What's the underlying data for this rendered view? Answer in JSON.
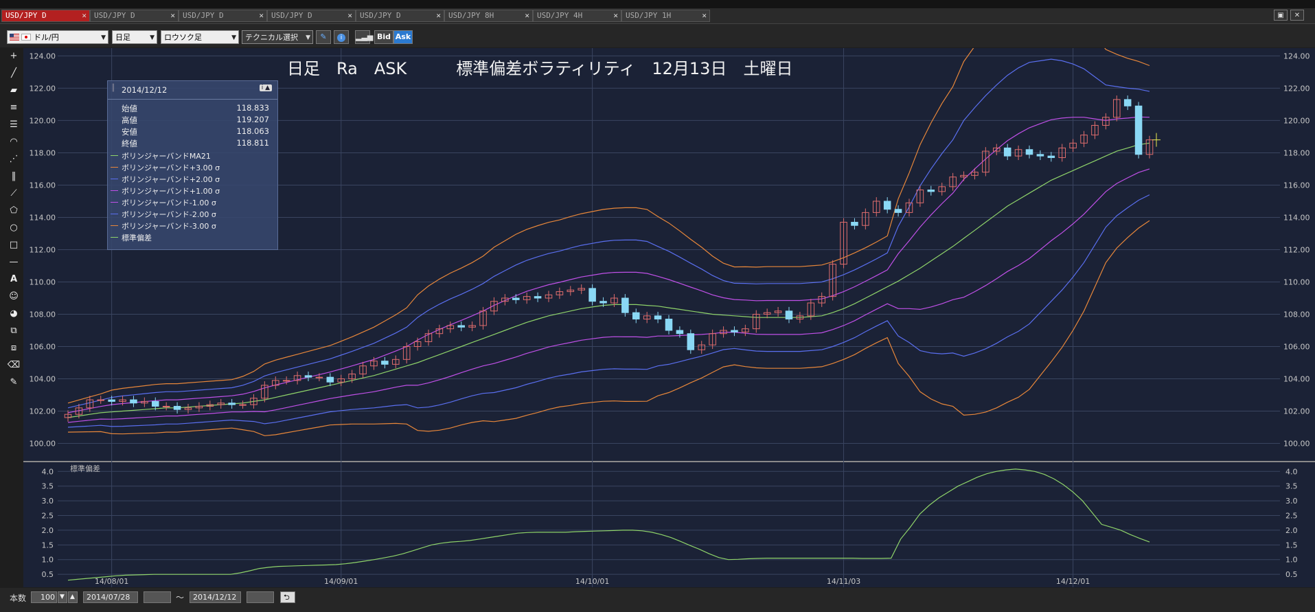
{
  "tabs": [
    {
      "label": "USD/JPY D",
      "active": true
    },
    {
      "label": "USD/JPY D"
    },
    {
      "label": "USD/JPY D"
    },
    {
      "label": "USD/JPY D"
    },
    {
      "label": "USD/JPY D"
    },
    {
      "label": "USD/JPY 8H"
    },
    {
      "label": "USD/JPY 4H"
    },
    {
      "label": "USD/JPY 1H"
    }
  ],
  "toolbar": {
    "currency_pair": "ドル/円",
    "period": "日足",
    "chart_type": "ロウソク足",
    "technical_select": "テクニカル選択",
    "bid_label": "Bid",
    "ask_label": "Ask"
  },
  "chart": {
    "title": "日足　Ra　ASK　　　標準偏差ボラティリティ　12月13日　土曜日",
    "sub_title": "標準偏差"
  },
  "infobox": {
    "date": "2014/12/12",
    "ohlc": [
      {
        "label": "始値",
        "value": "118.833"
      },
      {
        "label": "高値",
        "value": "119.207"
      },
      {
        "label": "安値",
        "value": "118.063"
      },
      {
        "label": "終値",
        "value": "118.811"
      }
    ],
    "legend": [
      {
        "label": "ボリンジャーバンドMA21",
        "color": "#8fd46a"
      },
      {
        "label": "ボリンジャーバンド+3.00 σ",
        "color": "#e8873a"
      },
      {
        "label": "ボリンジャーバンド+2.00 σ",
        "color": "#5a6ff0"
      },
      {
        "label": "ボリンジャーバンド+1.00 σ",
        "color": "#c050e8"
      },
      {
        "label": "ボリンジャーバンド-1.00 σ",
        "color": "#c050e8"
      },
      {
        "label": "ボリンジャーバンド-2.00 σ",
        "color": "#5a6ff0"
      },
      {
        "label": "ボリンジャーバンド-3.00 σ",
        "color": "#e8873a"
      },
      {
        "label": "標準偏差",
        "color": "#8fd46a"
      }
    ]
  },
  "statusbar": {
    "count_label": "本数",
    "count_value": "100",
    "start_date": "2014/07/28",
    "tilde": "～",
    "end_date": "2014/12/12"
  },
  "chart_data": {
    "type": "candlestick",
    "title": "日足　Ra　ASK　　　標準偏差ボラティリティ　12月13日　土曜日",
    "x_ticks": [
      "14/08/01",
      "14/09/01",
      "14/10/01",
      "14/11/03",
      "14/12/01"
    ],
    "y_ticks": [
      "100.00",
      "102.00",
      "104.00",
      "106.00",
      "108.00",
      "110.00",
      "112.00",
      "114.00",
      "116.00",
      "118.00",
      "120.00",
      "122.00",
      "124.00"
    ],
    "ylim": [
      99.3,
      124.4
    ],
    "sub_y_ticks": [
      "0.5",
      "1.0",
      "1.5",
      "2.0",
      "2.5",
      "3.0",
      "3.5",
      "4.0"
    ],
    "sub_ylim": [
      0.2,
      4.1
    ],
    "bull_color": "#e06d6d",
    "bear_color": "#8ad8f5",
    "closes": [
      101.8,
      102.2,
      102.7,
      102.7,
      102.6,
      102.7,
      102.5,
      102.6,
      102.3,
      102.3,
      102.1,
      102.2,
      102.3,
      102.4,
      102.5,
      102.4,
      102.4,
      102.8,
      103.6,
      103.9,
      103.9,
      104.2,
      104.1,
      104.1,
      103.8,
      104.0,
      104.3,
      104.8,
      105.1,
      104.9,
      105.2,
      106.0,
      106.3,
      106.8,
      107.1,
      107.3,
      107.2,
      107.3,
      108.2,
      108.8,
      109.0,
      108.9,
      109.1,
      109.0,
      109.2,
      109.4,
      109.5,
      109.6,
      108.8,
      108.7,
      109.0,
      108.1,
      107.7,
      107.9,
      107.7,
      107.0,
      106.8,
      105.8,
      106.1,
      106.8,
      107.0,
      106.9,
      107.1,
      108.0,
      108.1,
      108.2,
      107.7,
      107.9,
      108.7,
      109.1,
      111.1,
      113.7,
      113.5,
      114.3,
      115.0,
      114.5,
      114.3,
      114.9,
      115.7,
      115.6,
      115.9,
      116.5,
      116.6,
      116.8,
      118.1,
      118.3,
      117.8,
      118.2,
      117.9,
      117.8,
      117.7,
      118.3,
      118.6,
      119.1,
      119.7,
      120.2,
      121.3,
      120.9,
      117.9,
      118.8
    ],
    "ma21": [
      101.6,
      101.7,
      101.8,
      101.9,
      101.95,
      102.0,
      102.05,
      102.1,
      102.15,
      102.2,
      102.2,
      102.25,
      102.3,
      102.35,
      102.4,
      102.45,
      102.5,
      102.6,
      102.7,
      102.85,
      103.0,
      103.15,
      103.3,
      103.45,
      103.6,
      103.75,
      103.9,
      104.05,
      104.2,
      104.4,
      104.6,
      104.8,
      105.0,
      105.25,
      105.5,
      105.75,
      106.0,
      106.25,
      106.5,
      106.75,
      107.0,
      107.25,
      107.5,
      107.7,
      107.9,
      108.05,
      108.2,
      108.35,
      108.45,
      108.55,
      108.6,
      108.6,
      108.6,
      108.55,
      108.5,
      108.4,
      108.3,
      108.2,
      108.1,
      108.0,
      107.95,
      107.9,
      107.85,
      107.8,
      107.8,
      107.8,
      107.8,
      107.8,
      107.85,
      107.9,
      108.1,
      108.35,
      108.65,
      109.0,
      109.35,
      109.7,
      110.05,
      110.45,
      110.85,
      111.3,
      111.75,
      112.2,
      112.7,
      113.2,
      113.7,
      114.2,
      114.7,
      115.1,
      115.5,
      115.9,
      116.3,
      116.6,
      116.9,
      117.2,
      117.5,
      117.8,
      118.1,
      118.3,
      118.5,
      118.6
    ],
    "std": [
      0.3,
      0.33,
      0.36,
      0.39,
      0.42,
      0.45,
      0.47,
      0.48,
      0.49,
      0.5,
      0.5,
      0.5,
      0.5,
      0.5,
      0.5,
      0.5,
      0.5,
      0.5,
      0.55,
      0.62,
      0.7,
      0.74,
      0.77,
      0.78,
      0.79,
      0.8,
      0.81,
      0.82,
      0.83,
      0.86,
      0.9,
      0.95,
      1.0,
      1.06,
      1.12,
      1.2,
      1.3,
      1.4,
      1.5,
      1.56,
      1.6,
      1.62,
      1.65,
      1.7,
      1.75,
      1.8,
      1.85,
      1.9,
      1.92,
      1.93,
      1.93,
      1.93,
      1.93,
      1.95,
      1.96,
      1.97,
      1.98,
      1.99,
      2.0,
      2.0,
      1.98,
      1.93,
      1.85,
      1.75,
      1.62,
      1.48,
      1.35,
      1.2,
      1.07,
      1.0,
      1.01,
      1.03,
      1.04,
      1.05,
      1.05,
      1.05,
      1.05,
      1.05,
      1.05,
      1.05,
      1.05,
      1.05,
      1.05,
      1.04,
      1.04,
      1.04,
      1.05,
      1.7,
      2.1,
      2.55,
      2.85,
      3.1,
      3.3,
      3.5,
      3.65,
      3.8,
      3.92,
      4.0,
      4.05,
      4.08,
      4.05,
      4.0,
      3.9,
      3.75,
      3.55,
      3.3,
      3.0,
      2.6,
      2.2,
      2.1,
      2.0,
      1.85,
      1.72,
      1.6
    ]
  }
}
